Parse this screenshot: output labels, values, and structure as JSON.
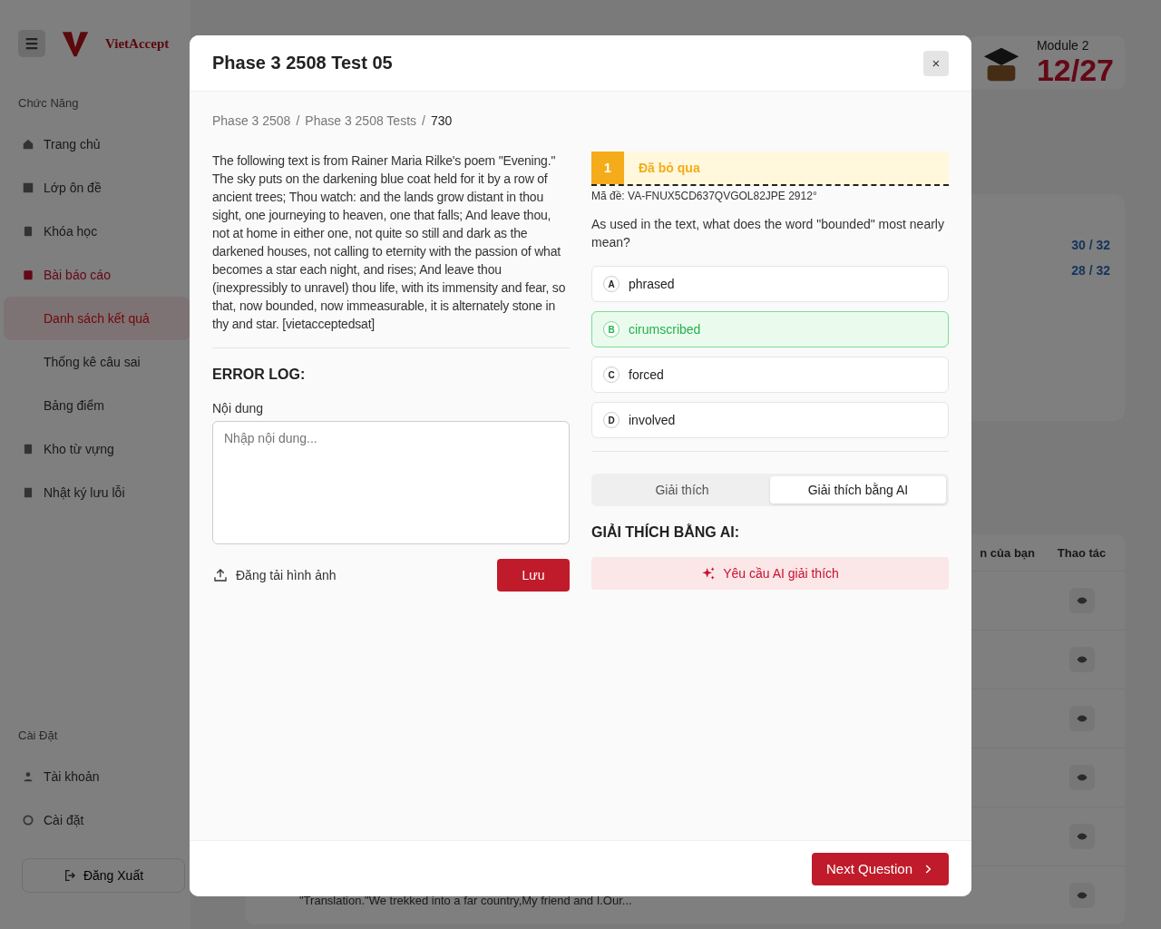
{
  "background": {
    "sidebar": {
      "logo_text": "VietAccept",
      "sections": [
        {
          "title": "Chức Năng",
          "items": [
            {
              "label": "Trang chủ",
              "selected": false
            },
            {
              "label": "Lớp ôn đề",
              "selected": false
            },
            {
              "label": "Khóa học",
              "selected": false
            },
            {
              "label": "Bài báo cáo",
              "selected": true,
              "expanded": true,
              "children": [
                {
                  "label": "Danh sách kết quả",
                  "selected": true
                },
                {
                  "label": "Thống kê câu sai",
                  "selected": false
                },
                {
                  "label": "Bảng điểm",
                  "selected": false
                }
              ]
            },
            {
              "label": "Kho từ vựng",
              "selected": false
            },
            {
              "label": "Nhật ký lưu lỗi",
              "selected": false
            }
          ]
        },
        {
          "title": "Cài Đặt",
          "items": [
            {
              "label": "Tài khoản",
              "selected": false
            },
            {
              "label": "Cài đặt",
              "selected": false
            }
          ]
        }
      ],
      "logout": "Đăng Xuất"
    },
    "module_card": {
      "label": "Module 2",
      "value": "12/27"
    },
    "scores": [
      "30 / 32",
      "28 / 32"
    ],
    "table": {
      "columns": [
        "n của bạn",
        "Thao tác"
      ],
      "rows": [
        {
          "kind": "view"
        },
        {
          "kind": "view"
        },
        {
          "kind": "view"
        },
        {
          "kind": "view"
        },
        {
          "kind": "view"
        },
        {
          "kind": "view"
        }
      ]
    },
    "bottom_text": "\"Translation.\"We trekked into a far country,My friend and I.Our..."
  },
  "modal": {
    "title": "Phase 3 2508 Test 05",
    "close": "×",
    "breadcrumb": [
      {
        "kind": "link",
        "text": "Phase 3 2508"
      },
      {
        "kind": "separator",
        "text": "/"
      },
      {
        "kind": "link",
        "text": "Phase 3 2508 Tests"
      },
      {
        "kind": "separator",
        "text": "/"
      },
      {
        "kind": "current",
        "text": "730"
      }
    ],
    "passage": "The following text is from Rainer Maria Rilke's poem \"Evening.\" The sky puts on the darkening blue coat held for it by a row of ancient trees; Thou watch: and the lands grow distant in thou sight, one journeying to heaven, one that falls; And leave thou, not at home in either one, not quite so still and dark as the darkened houses, not calling to eternity with the passion of what becomes a star each night, and rises; And leave thou (inexpressibly to unravel) thou life, with its immensity and fear, so that, now bounded, now immeasurable, it is alternately stone in thy and star. [vietacceptedsat]",
    "error_log": {
      "heading": "ERROR LOG:",
      "field_label": "Nội dung",
      "placeholder": "Nhập nội dung...",
      "upload": "Đăng tải hình ảnh",
      "save": "Lưu"
    },
    "question": {
      "number": "1",
      "status": "Đã bỏ qua",
      "code": "Mã đề: VA-FNUX5CD637QVGOL82JPE 2912°",
      "prompt": "As used in the text, what does the word \"bounded\" most nearly mean?",
      "options": [
        {
          "letter": "A",
          "text": "phrased",
          "selected": false
        },
        {
          "letter": "B",
          "text": "cirumscribed",
          "selected": true
        },
        {
          "letter": "C",
          "text": "forced",
          "selected": false
        },
        {
          "letter": "D",
          "text": "involved",
          "selected": false
        }
      ]
    },
    "tabs": [
      {
        "label": "Giải thích",
        "selected": false
      },
      {
        "label": "Giải thích bằng AI",
        "selected": true
      }
    ],
    "ai_heading": "GIẢI THÍCH BẰNG AI:",
    "ai_button": "Yêu cầu AI giải thích",
    "next_button": "Next Question"
  }
}
